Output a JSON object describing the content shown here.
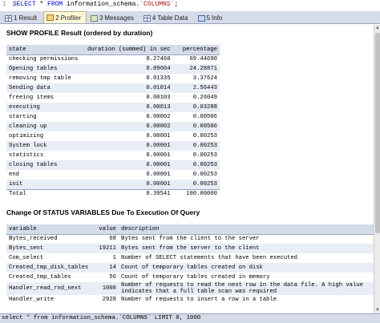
{
  "editor": {
    "line_number": "1",
    "sql_keyword1": "SELECT",
    "sql_star": " * ",
    "sql_keyword2": "FROM",
    "sql_rest": " information_schema.",
    "sql_string": "`COLUMNS`",
    "sql_end": ";"
  },
  "tabs": [
    {
      "number": "1",
      "label": "Result"
    },
    {
      "number": "2",
      "label": "Profiler"
    },
    {
      "number": "3",
      "label": "Messages"
    },
    {
      "number": "4",
      "label": "Table Data"
    },
    {
      "number": "5",
      "label": "Info"
    }
  ],
  "profile": {
    "title": "SHOW PROFILE Result (ordered by duration)",
    "headers": [
      "state",
      "duration (summed) in sec",
      "percentage"
    ],
    "rows": [
      {
        "state": "checking permissions",
        "duration": "0.27460",
        "percentage": "69.44690"
      },
      {
        "state": "Opening tables",
        "duration": "0.09604",
        "percentage": "24.28871"
      },
      {
        "state": "removing tmp table",
        "duration": "0.01335",
        "percentage": "3.37624"
      },
      {
        "state": "Sending data",
        "duration": "0.01014",
        "percentage": "2.56443"
      },
      {
        "state": "freeing items",
        "duration": "0.00103",
        "percentage": "0.26049"
      },
      {
        "state": "executing",
        "duration": "0.00013",
        "percentage": "0.03288"
      },
      {
        "state": "starting",
        "duration": "0.00002",
        "percentage": "0.00506"
      },
      {
        "state": "cleaning up",
        "duration": "0.00002",
        "percentage": "0.00506"
      },
      {
        "state": "optimizing",
        "duration": "0.00001",
        "percentage": "0.00253"
      },
      {
        "state": "System lock",
        "duration": "0.00001",
        "percentage": "0.00253"
      },
      {
        "state": "statistics",
        "duration": "0.00001",
        "percentage": "0.00253"
      },
      {
        "state": "closing tables",
        "duration": "0.00001",
        "percentage": "0.00253"
      },
      {
        "state": "end",
        "duration": "0.00001",
        "percentage": "0.00253"
      },
      {
        "state": "init",
        "duration": "0.00001",
        "percentage": "0.00253"
      }
    ],
    "total": {
      "state": "Total",
      "duration": "0.39541",
      "percentage": "100.00000"
    }
  },
  "status_vars": {
    "title": "Change Of STATUS VARIABLES Due To Execution Of Query",
    "headers": [
      "variable",
      "value",
      "description"
    ],
    "rows": [
      {
        "variable": "Bytes_received",
        "value": "68",
        "description": "Bytes sent from the client to the server"
      },
      {
        "variable": "Bytes_sent",
        "value": "19211",
        "description": "Bytes sent from the server to the client"
      },
      {
        "variable": "Com_select",
        "value": "1",
        "description": "Number of SELECT statements that have been executed"
      },
      {
        "variable": "Created_tmp_disk_tables",
        "value": "14",
        "description": "Count of temporary tables created on disk"
      },
      {
        "variable": "Created_tmp_tables",
        "value": "56",
        "description": "Count of temporary tables created in memory"
      },
      {
        "variable": "Handler_read_rnd_next",
        "value": "1000",
        "description": "Number of requests to read the next row in the data file. A high value indicates that a full table scan was required"
      },
      {
        "variable": "Handler_write",
        "value": "2928",
        "description": "Number of requests to insert a row in a table"
      }
    ]
  },
  "statusbar": {
    "text": "select * from information_schema.`COLUMNS` LIMIT 0, 1000"
  }
}
